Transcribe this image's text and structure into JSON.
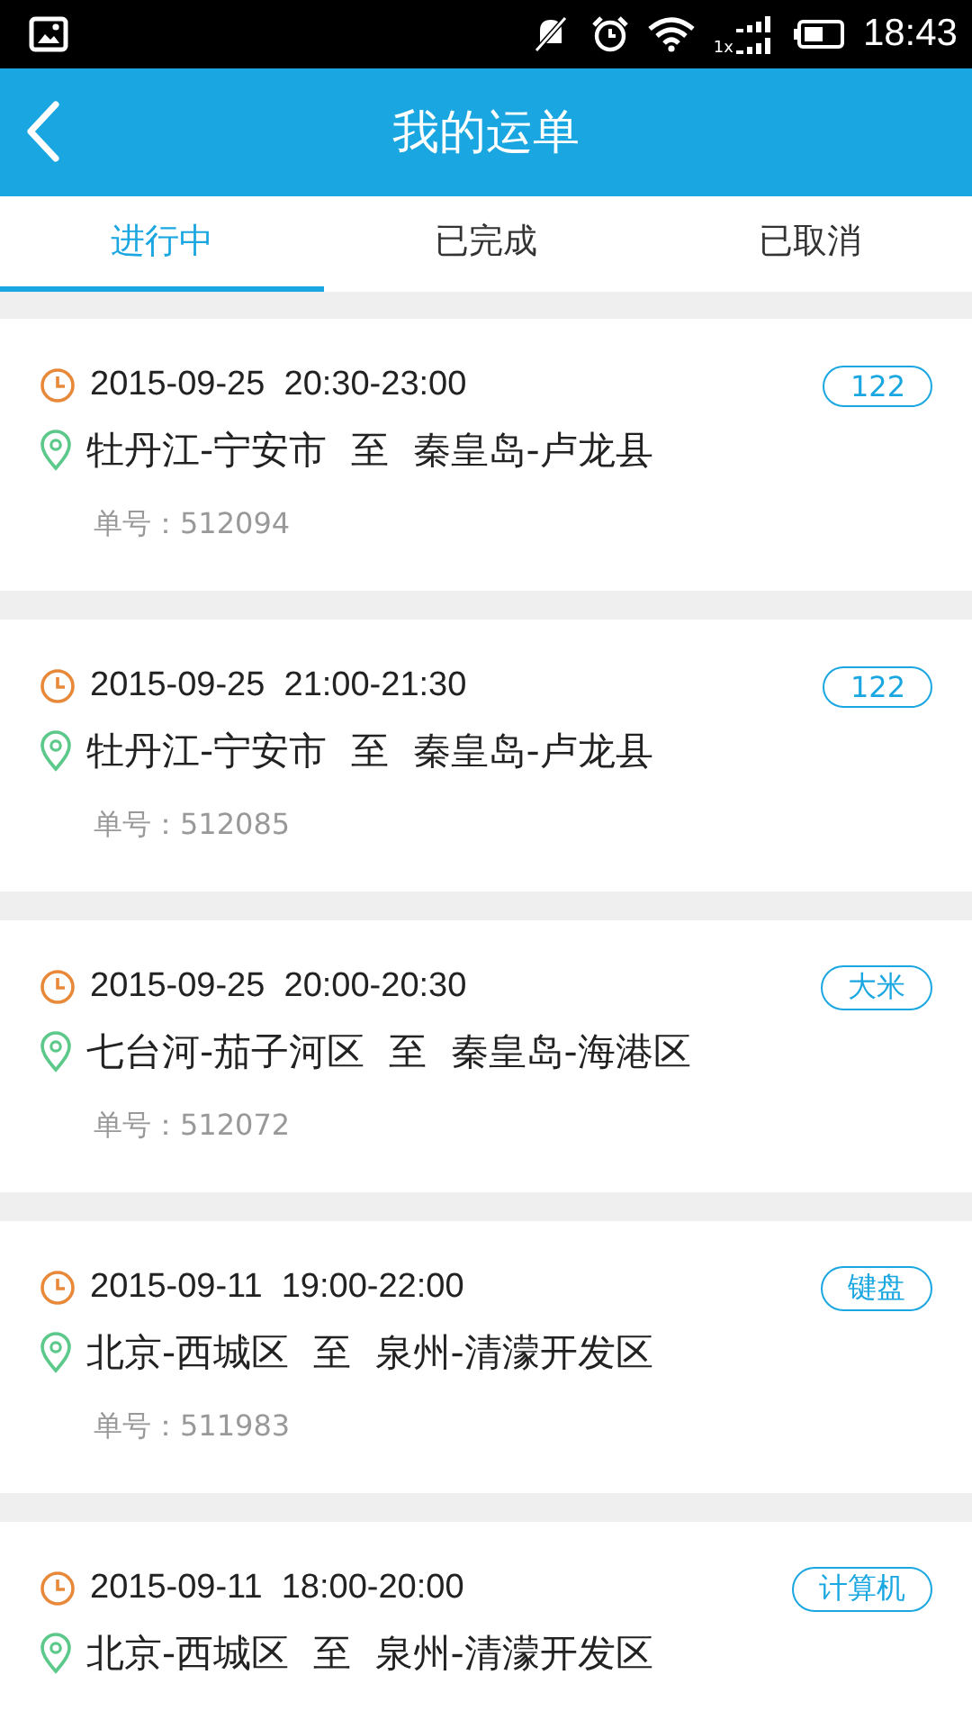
{
  "status_bar": {
    "network_label": "1x",
    "time": "18:43"
  },
  "header": {
    "title": "我的运单"
  },
  "tabs": [
    {
      "label": "进行中",
      "selected": true
    },
    {
      "label": "已完成",
      "selected": false
    },
    {
      "label": "已取消",
      "selected": false
    }
  ],
  "orders": [
    {
      "time": "2015-09-25  20:30-23:00",
      "tag": "122",
      "route": "牡丹江-宁安市  至  秦皇岛-卢龙县",
      "order_no": "单号：512094"
    },
    {
      "time": "2015-09-25  21:00-21:30",
      "tag": "122",
      "route": "牡丹江-宁安市  至  秦皇岛-卢龙县",
      "order_no": "单号：512085"
    },
    {
      "time": "2015-09-25  20:00-20:30",
      "tag": "大米",
      "route": "七台河-茄子河区  至  秦皇岛-海港区",
      "order_no": "单号：512072"
    },
    {
      "time": "2015-09-11  19:00-22:00",
      "tag": "键盘",
      "route": "北京-西城区  至  泉州-清濛开发区",
      "order_no": "单号：511983"
    },
    {
      "time": "2015-09-11  18:00-20:00",
      "tag": "计算机",
      "route": "北京-西城区  至  泉州-清濛开发区"
    }
  ]
}
